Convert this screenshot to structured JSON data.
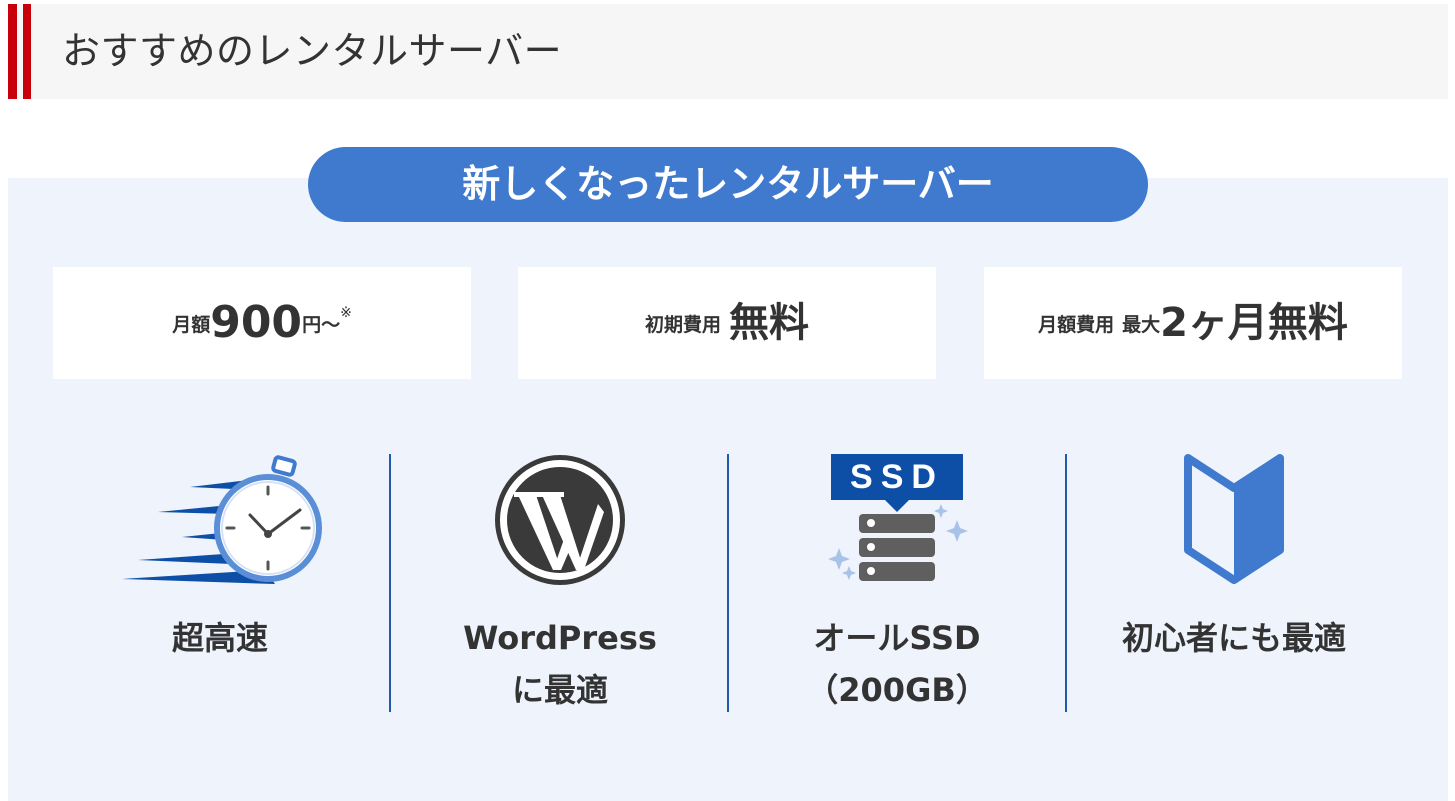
{
  "header": {
    "title": "おすすめのレンタルサーバー"
  },
  "banner": {
    "title": "新しくなったレンタルサーバー"
  },
  "cards": [
    {
      "prefix": "月額",
      "value": "900",
      "suffix": "円～",
      "note": "※"
    },
    {
      "prefix": "初期費用",
      "value": "無料"
    },
    {
      "prefix": "月額費用",
      "middle": "最大",
      "value": "2ヶ月無料"
    }
  ],
  "features": [
    {
      "icon": "stopwatch-speed-icon",
      "line1": "超高速",
      "line2": ""
    },
    {
      "icon": "wordpress-logo-icon",
      "line1": "WordPress",
      "line2": "に最適"
    },
    {
      "icon": "ssd-server-icon",
      "badge": "SSD",
      "line1": "オールSSD",
      "line2": "（200GB）"
    },
    {
      "icon": "beginner-mark-icon",
      "line1": "初心者にも最適",
      "line2": ""
    }
  ],
  "colors": {
    "accent_red": "#c7000b",
    "brand_blue": "#3f7ace",
    "dark_blue": "#0d4fa6",
    "panel_bg": "#eef3fc",
    "text": "#333333"
  }
}
